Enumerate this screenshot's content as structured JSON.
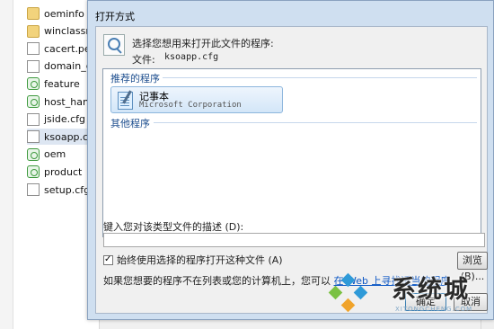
{
  "explorer": {
    "files": [
      {
        "name": "oeminfo",
        "type": "folder",
        "selected": false
      },
      {
        "name": "winclassn",
        "type": "folder",
        "selected": false
      },
      {
        "name": "cacert.pe",
        "type": "doc",
        "selected": false
      },
      {
        "name": "domain_c",
        "type": "doc",
        "selected": false
      },
      {
        "name": "feature",
        "type": "web",
        "selected": false
      },
      {
        "name": "host_hand",
        "type": "web",
        "selected": false
      },
      {
        "name": "jside.cfg",
        "type": "doc",
        "selected": false
      },
      {
        "name": "ksoapp.c",
        "type": "doc",
        "selected": true
      },
      {
        "name": "oem",
        "type": "web",
        "selected": false
      },
      {
        "name": "product",
        "type": "web",
        "selected": false
      },
      {
        "name": "setup.cfg",
        "type": "doc",
        "selected": false
      }
    ]
  },
  "dialog": {
    "title": "打开方式",
    "instruction": "选择您想用来打开此文件的程序:",
    "file_label": "文件:",
    "file_name": "ksoapp.cfg",
    "recommended_header": "推荐的程序",
    "recommended_program": {
      "name": "记事本",
      "company": "Microsoft Corporation"
    },
    "other_header": "其他程序",
    "description_label": "键入您对该类型文件的描述 (D):",
    "description_value": "",
    "always_use_label": "始终使用选择的程序打开这种文件 (A)",
    "always_use_checked": "✓",
    "browse_button": "浏览(B)...",
    "note_text": "如果您想要的程序不在列表或您的计算机上，您可以",
    "note_link": "在 Web 上寻找适当的程序",
    "note_end": "。",
    "ok_button": "确定",
    "cancel_button": "取消"
  },
  "watermark": {
    "text": "系统城",
    "subtext": "XITONGCHENG.COM",
    "colors": [
      "#2f9ad8",
      "#7ac143",
      "#2f9ad8",
      "#f0a32a"
    ]
  },
  "colors": {
    "link": "#0b56c4",
    "group_header": "#1e4f8f",
    "frame": "#cfdff0"
  }
}
